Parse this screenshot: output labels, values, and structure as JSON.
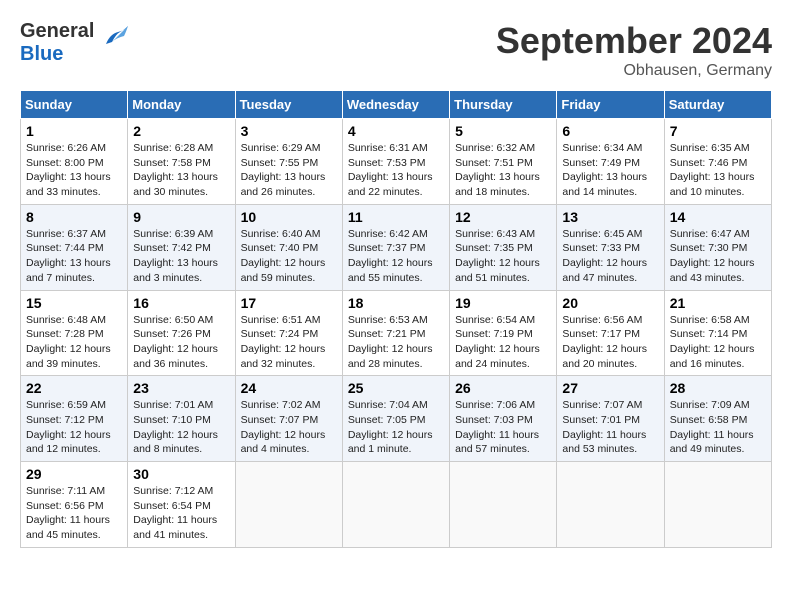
{
  "header": {
    "logo_general": "General",
    "logo_blue": "Blue",
    "month": "September 2024",
    "location": "Obhausen, Germany"
  },
  "days_of_week": [
    "Sunday",
    "Monday",
    "Tuesday",
    "Wednesday",
    "Thursday",
    "Friday",
    "Saturday"
  ],
  "weeks": [
    [
      {
        "day": "1",
        "sunrise": "6:26 AM",
        "sunset": "8:00 PM",
        "daylight": "13 hours and 33 minutes."
      },
      {
        "day": "2",
        "sunrise": "6:28 AM",
        "sunset": "7:58 PM",
        "daylight": "13 hours and 30 minutes."
      },
      {
        "day": "3",
        "sunrise": "6:29 AM",
        "sunset": "7:55 PM",
        "daylight": "13 hours and 26 minutes."
      },
      {
        "day": "4",
        "sunrise": "6:31 AM",
        "sunset": "7:53 PM",
        "daylight": "13 hours and 22 minutes."
      },
      {
        "day": "5",
        "sunrise": "6:32 AM",
        "sunset": "7:51 PM",
        "daylight": "13 hours and 18 minutes."
      },
      {
        "day": "6",
        "sunrise": "6:34 AM",
        "sunset": "7:49 PM",
        "daylight": "13 hours and 14 minutes."
      },
      {
        "day": "7",
        "sunrise": "6:35 AM",
        "sunset": "7:46 PM",
        "daylight": "13 hours and 10 minutes."
      }
    ],
    [
      {
        "day": "8",
        "sunrise": "6:37 AM",
        "sunset": "7:44 PM",
        "daylight": "13 hours and 7 minutes."
      },
      {
        "day": "9",
        "sunrise": "6:39 AM",
        "sunset": "7:42 PM",
        "daylight": "13 hours and 3 minutes."
      },
      {
        "day": "10",
        "sunrise": "6:40 AM",
        "sunset": "7:40 PM",
        "daylight": "12 hours and 59 minutes."
      },
      {
        "day": "11",
        "sunrise": "6:42 AM",
        "sunset": "7:37 PM",
        "daylight": "12 hours and 55 minutes."
      },
      {
        "day": "12",
        "sunrise": "6:43 AM",
        "sunset": "7:35 PM",
        "daylight": "12 hours and 51 minutes."
      },
      {
        "day": "13",
        "sunrise": "6:45 AM",
        "sunset": "7:33 PM",
        "daylight": "12 hours and 47 minutes."
      },
      {
        "day": "14",
        "sunrise": "6:47 AM",
        "sunset": "7:30 PM",
        "daylight": "12 hours and 43 minutes."
      }
    ],
    [
      {
        "day": "15",
        "sunrise": "6:48 AM",
        "sunset": "7:28 PM",
        "daylight": "12 hours and 39 minutes."
      },
      {
        "day": "16",
        "sunrise": "6:50 AM",
        "sunset": "7:26 PM",
        "daylight": "12 hours and 36 minutes."
      },
      {
        "day": "17",
        "sunrise": "6:51 AM",
        "sunset": "7:24 PM",
        "daylight": "12 hours and 32 minutes."
      },
      {
        "day": "18",
        "sunrise": "6:53 AM",
        "sunset": "7:21 PM",
        "daylight": "12 hours and 28 minutes."
      },
      {
        "day": "19",
        "sunrise": "6:54 AM",
        "sunset": "7:19 PM",
        "daylight": "12 hours and 24 minutes."
      },
      {
        "day": "20",
        "sunrise": "6:56 AM",
        "sunset": "7:17 PM",
        "daylight": "12 hours and 20 minutes."
      },
      {
        "day": "21",
        "sunrise": "6:58 AM",
        "sunset": "7:14 PM",
        "daylight": "12 hours and 16 minutes."
      }
    ],
    [
      {
        "day": "22",
        "sunrise": "6:59 AM",
        "sunset": "7:12 PM",
        "daylight": "12 hours and 12 minutes."
      },
      {
        "day": "23",
        "sunrise": "7:01 AM",
        "sunset": "7:10 PM",
        "daylight": "12 hours and 8 minutes."
      },
      {
        "day": "24",
        "sunrise": "7:02 AM",
        "sunset": "7:07 PM",
        "daylight": "12 hours and 4 minutes."
      },
      {
        "day": "25",
        "sunrise": "7:04 AM",
        "sunset": "7:05 PM",
        "daylight": "12 hours and 1 minute."
      },
      {
        "day": "26",
        "sunrise": "7:06 AM",
        "sunset": "7:03 PM",
        "daylight": "11 hours and 57 minutes."
      },
      {
        "day": "27",
        "sunrise": "7:07 AM",
        "sunset": "7:01 PM",
        "daylight": "11 hours and 53 minutes."
      },
      {
        "day": "28",
        "sunrise": "7:09 AM",
        "sunset": "6:58 PM",
        "daylight": "11 hours and 49 minutes."
      }
    ],
    [
      {
        "day": "29",
        "sunrise": "7:11 AM",
        "sunset": "6:56 PM",
        "daylight": "11 hours and 45 minutes."
      },
      {
        "day": "30",
        "sunrise": "7:12 AM",
        "sunset": "6:54 PM",
        "daylight": "11 hours and 41 minutes."
      },
      null,
      null,
      null,
      null,
      null
    ]
  ]
}
